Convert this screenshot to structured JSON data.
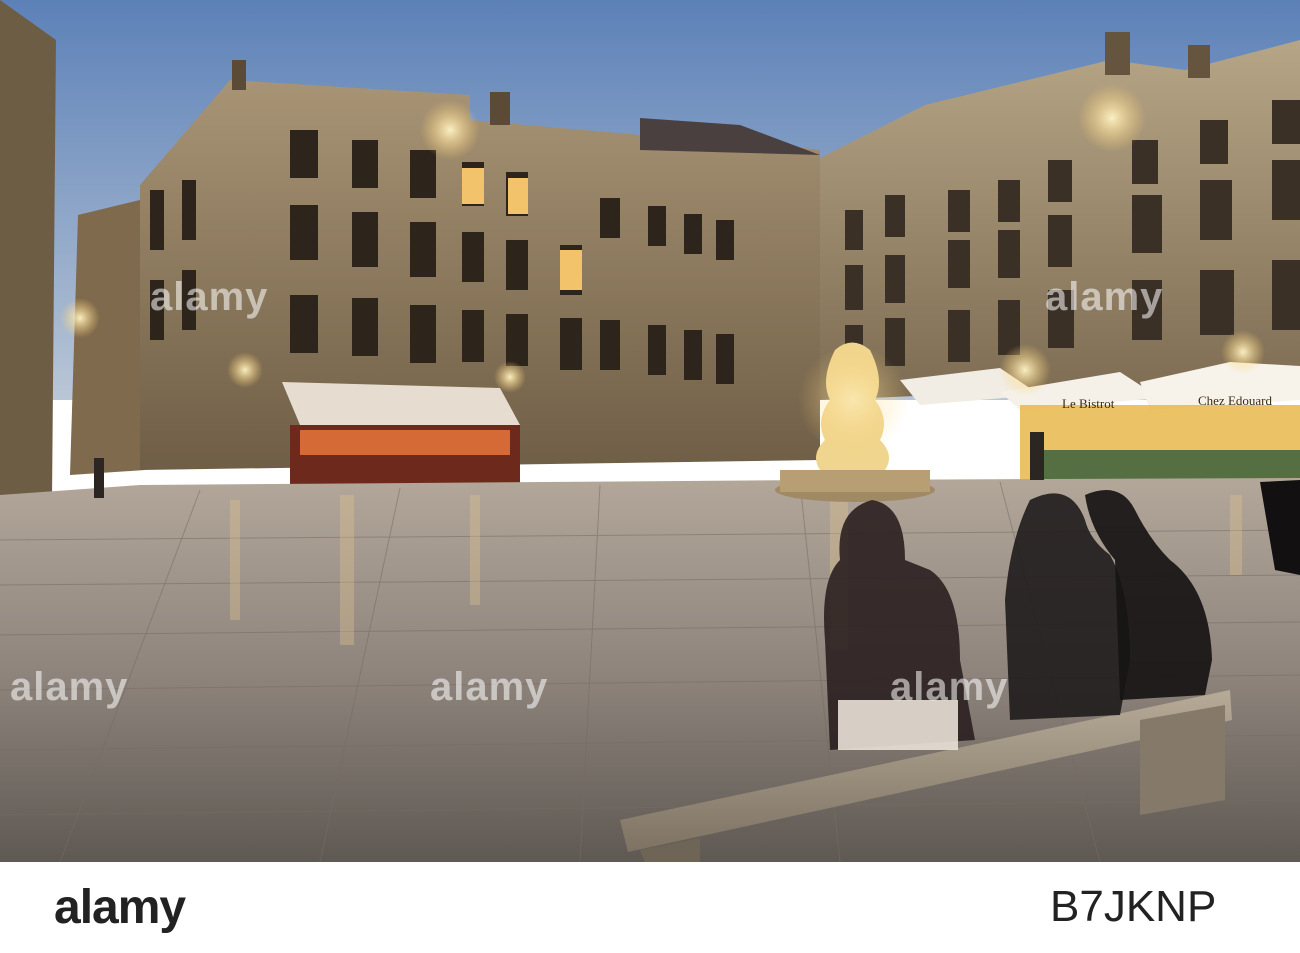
{
  "photo": {
    "sign_left": "Chez Edouard",
    "sign_right": "Le Bistrot"
  },
  "watermarks": [
    "alamy",
    "alamy",
    "alamy",
    "alamy",
    "alamy"
  ],
  "footer": {
    "brand": "alamy",
    "image_code": "B7JKNP"
  },
  "colors": {
    "sky": "#7a9cc6",
    "stone": "#c9b48c",
    "pavement": "#9a8f86",
    "lamp": "#ffd58a"
  }
}
